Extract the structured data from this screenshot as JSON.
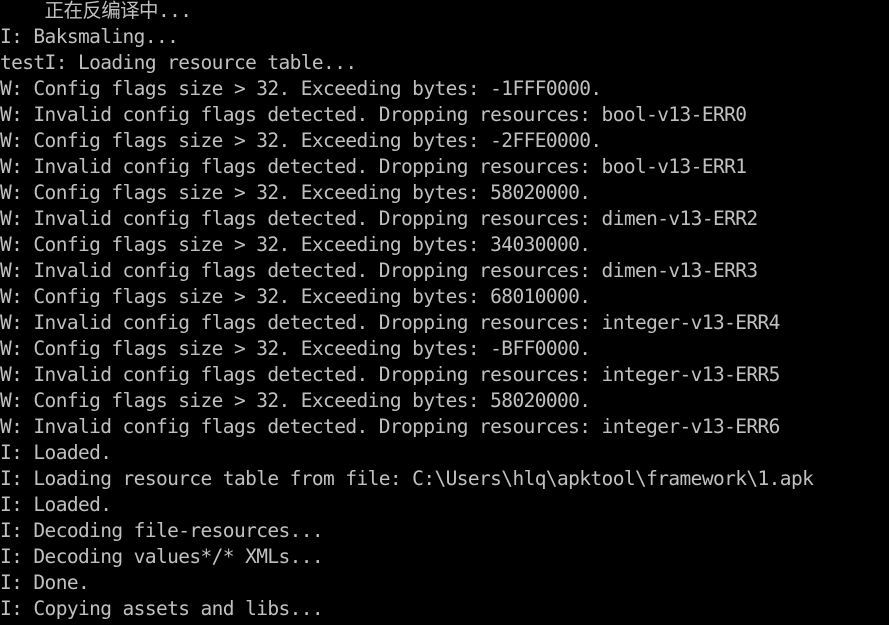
{
  "terminal": {
    "lines": [
      "    正在反编译中...",
      "I: Baksmaling...",
      "testI: Loading resource table...",
      "W: Config flags size > 32. Exceeding bytes: -1FFF0000.",
      "W: Invalid config flags detected. Dropping resources: bool-v13-ERR0",
      "W: Config flags size > 32. Exceeding bytes: -2FFE0000.",
      "W: Invalid config flags detected. Dropping resources: bool-v13-ERR1",
      "W: Config flags size > 32. Exceeding bytes: 58020000.",
      "W: Invalid config flags detected. Dropping resources: dimen-v13-ERR2",
      "W: Config flags size > 32. Exceeding bytes: 34030000.",
      "W: Invalid config flags detected. Dropping resources: dimen-v13-ERR3",
      "W: Config flags size > 32. Exceeding bytes: 68010000.",
      "W: Invalid config flags detected. Dropping resources: integer-v13-ERR4",
      "W: Config flags size > 32. Exceeding bytes: -BFF0000.",
      "W: Invalid config flags detected. Dropping resources: integer-v13-ERR5",
      "W: Config flags size > 32. Exceeding bytes: 58020000.",
      "W: Invalid config flags detected. Dropping resources: integer-v13-ERR6",
      "I: Loaded.",
      "I: Loading resource table from file: C:\\Users\\hlq\\apktool\\framework\\1.apk",
      "I: Loaded.",
      "I: Decoding file-resources...",
      "I: Decoding values*/* XMLs...",
      "I: Done.",
      "I: Copying assets and libs..."
    ]
  },
  "colors": {
    "background": "#000000",
    "text": "#c0c0c0"
  }
}
